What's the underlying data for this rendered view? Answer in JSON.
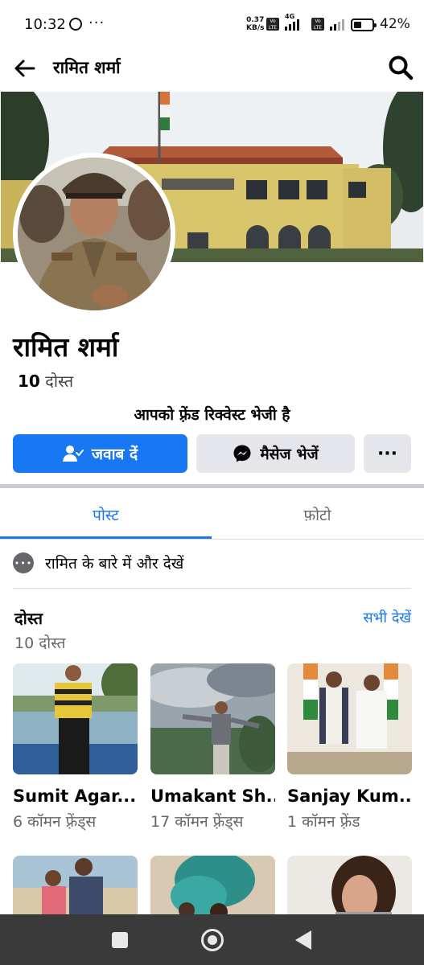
{
  "status_bar": {
    "time": "10:32",
    "app_icon": "whatsapp-icon",
    "more_indicator": "···",
    "net_speed_value": "0.37",
    "net_speed_unit": "KB/s",
    "sim_tag": "Vo LTE",
    "network_type": "4G",
    "battery_level": 0.42,
    "battery_percent": "42%"
  },
  "header": {
    "title": "रामित शर्मा",
    "back_icon": "arrow-left-icon",
    "search_icon": "search-icon"
  },
  "profile": {
    "name": "रामित शर्मा",
    "friends_count_number": "10",
    "friends_count_label": "दोस्त",
    "request_note": "आपको फ़्रेंड रिक्वेस्ट भेजी है"
  },
  "actions": {
    "respond_label": "जवाब दें",
    "respond_icon": "person-check-icon",
    "message_label": "मैसेज भेजें",
    "message_icon": "messenger-icon",
    "more_label": "···"
  },
  "tabs": [
    {
      "label": "पोस्ट",
      "active": true
    },
    {
      "label": "फ़ोटो",
      "active": false
    }
  ],
  "about": {
    "label": "रामित के बारे में और देखें",
    "icon": "more-dots-icon"
  },
  "friends_section": {
    "title": "दोस्त",
    "see_all": "सभी देखें",
    "subtitle": "10 दोस्त",
    "cards": [
      {
        "name": "Sumit Agar...",
        "mutual": "6 कॉमन फ़्रेंड्स"
      },
      {
        "name": "Umakant Sh...",
        "mutual": "17 कॉमन फ़्रेंड्स"
      },
      {
        "name": "Sanjay Kum...",
        "mutual": "1 कॉमन फ़्रेंड"
      }
    ]
  },
  "colors": {
    "brand": "#1877f2",
    "secondary_button": "#e4e6eb",
    "muted_text": "#65676b",
    "nav_bar": "#3a3a3a"
  }
}
